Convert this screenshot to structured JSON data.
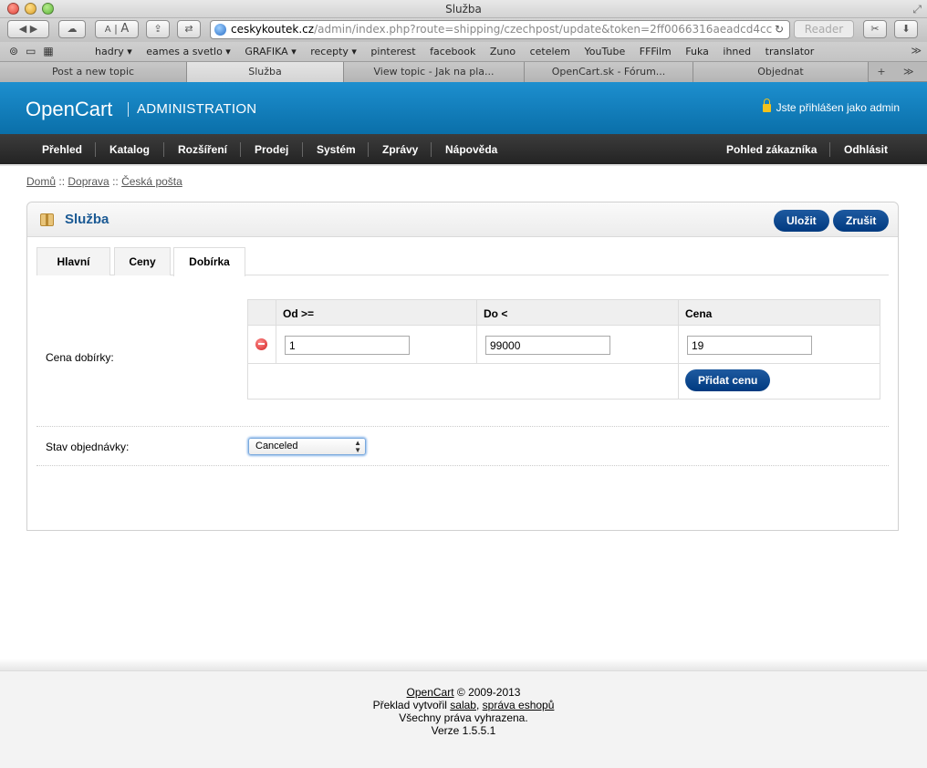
{
  "browser": {
    "window_title": "Služba",
    "url_host": "ceskykoutek.cz",
    "url_path": "/admin/index.php?route=shipping/czechpost/update&token=2ff0066316aeadcd4cc",
    "reader_label": "Reader",
    "font_small": "A",
    "font_large": "A",
    "bookmarks": [
      "hadry ▾",
      "eames a svetlo ▾",
      "GRAFIKA ▾",
      "recepty ▾",
      "pinterest",
      "facebook",
      "Zuno",
      "cetelem",
      "YouTube",
      "FFFilm",
      "Fuka",
      "ihned",
      "translator"
    ],
    "tabs": [
      "Post a new topic",
      "Služba",
      "View topic - Jak na pla...",
      "OpenCart.sk - Fórum...",
      "Objednat"
    ]
  },
  "header": {
    "logo": "OpenCart",
    "admin_label": "ADMINISTRATION",
    "user_text": "Jste přihlášen jako admin"
  },
  "menu": {
    "left": [
      "Přehled",
      "Katalog",
      "Rozšíření",
      "Prodej",
      "Systém",
      "Zprávy",
      "Nápověda"
    ],
    "right": [
      "Pohled zákazníka",
      "Odhlásit"
    ]
  },
  "breadcrumb": {
    "items": [
      "Domů",
      "Doprava",
      "Česká pošta"
    ],
    "separator": "::"
  },
  "panel": {
    "title": "Služba",
    "save_label": "Uložit",
    "cancel_label": "Zrušit",
    "tabs": [
      "Hlavní",
      "Ceny",
      "Dobírka"
    ],
    "active_tab": "Dobírka",
    "cod_label": "Cena dobírky:",
    "table_headers": [
      "Od >=",
      "Do <",
      "Cena"
    ],
    "rows": [
      {
        "from": "1",
        "to": "99000",
        "price": "19"
      }
    ],
    "add_price_label": "Přidat cenu",
    "order_status_label": "Stav objednávky:",
    "order_status_value": "Canceled"
  },
  "footer": {
    "brand": "OpenCart",
    "copyright": "© 2009-2013",
    "translation_prefix": "Překlad vytvořil",
    "translator": "salab",
    "comma": ",",
    "translator_link": "správa eshopů",
    "rights": "Všechny práva vyhrazena.",
    "version": "Verze 1.5.5.1"
  },
  "colors": {
    "header_blue": "#1481c0",
    "menu_dark": "#2f2f2f",
    "button_blue": "#003a80",
    "title_blue": "#1b5a94"
  }
}
